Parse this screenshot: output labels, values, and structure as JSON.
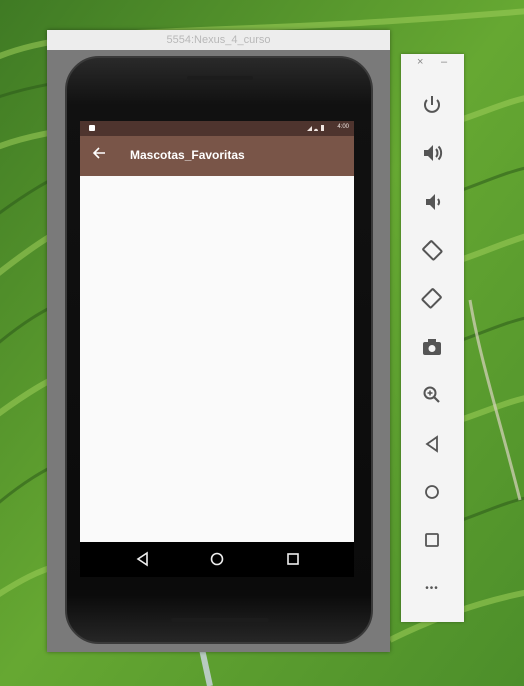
{
  "window": {
    "title": "5554:Nexus_4_curso"
  },
  "status_bar": {
    "time": "4:00",
    "icons": "signal-wifi-battery"
  },
  "app_bar": {
    "back_icon": "arrow-back-icon",
    "title": "Mascotas_Favoritas",
    "color": "#795548",
    "status_color": "#4e342e"
  },
  "nav_bar": {
    "buttons": [
      "back",
      "home",
      "recents"
    ]
  },
  "toolbar": {
    "window_controls": [
      "×",
      "–"
    ],
    "buttons": [
      "power",
      "volume-up",
      "volume-down",
      "rotate-left",
      "rotate-right",
      "camera",
      "zoom",
      "back",
      "home",
      "overview",
      "more"
    ],
    "more_label": "•••"
  }
}
